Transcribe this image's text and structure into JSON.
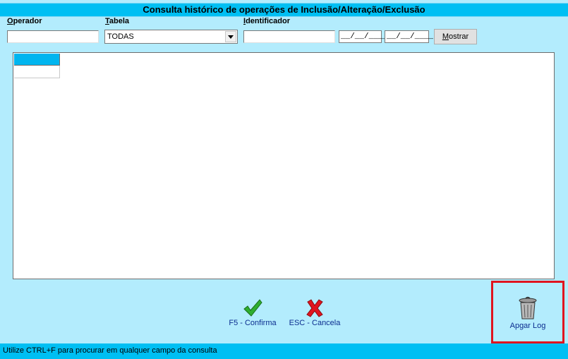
{
  "window": {
    "title": "Consulta histórico de operações de Inclusão/Alteração/Exclusão"
  },
  "filters": {
    "operador": {
      "label_key": "O",
      "label_rest": "perador",
      "value": ""
    },
    "tabela": {
      "label_key": "T",
      "label_rest": "abela",
      "selected": "TODAS"
    },
    "identificador": {
      "label_key": "I",
      "label_rest": "dentificador",
      "value": ""
    },
    "date_from": "__/__/____",
    "date_to": "__/__/____",
    "show_button": {
      "key": "M",
      "rest": "ostrar"
    }
  },
  "actions": {
    "confirm": {
      "label": "F5 - Confirma",
      "icon": "checkmark-icon",
      "color": "#2fae2f"
    },
    "cancel": {
      "label": "ESC - Cancela",
      "icon": "x-icon",
      "color": "#e0141f"
    },
    "clear_log": {
      "label": "Apgar Log",
      "icon": "trash-icon"
    }
  },
  "status": {
    "text": "Utilize CTRL+F  para procurar em qualquer campo da consulta"
  },
  "colors": {
    "title_bar": "#00bff3",
    "background": "#b3ecfd",
    "highlight": "#e0141f"
  }
}
